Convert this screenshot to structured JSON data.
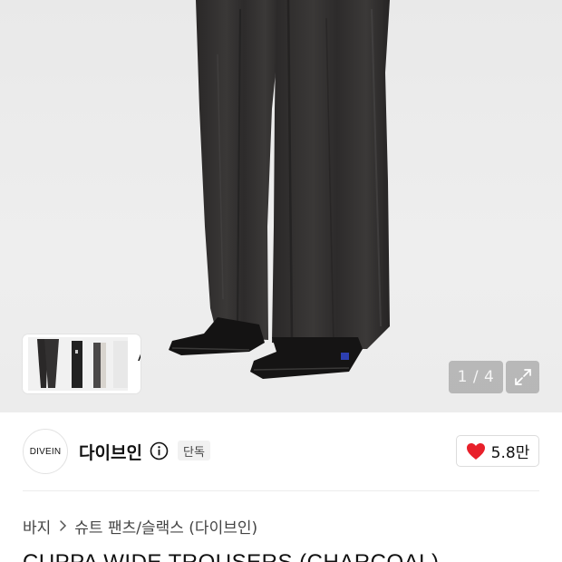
{
  "hero": {
    "image_desc": "charcoal wide trousers product photo",
    "thumbs_ai_label": "AI",
    "counter_text": "1 / 4",
    "icons": {
      "chevron": "chevron-right-icon",
      "expand": "expand-icon"
    }
  },
  "brand": {
    "logo_text": "DIVEIN",
    "name": "다이브인",
    "badge": "단독",
    "like_count": "5.8만",
    "colors": {
      "heart": "#e8202a"
    }
  },
  "breadcrumb": {
    "items": [
      "바지",
      "슈트 팬츠/슬랙스 (다이브인)"
    ]
  },
  "product": {
    "title": "CUPPA WIDE TROUSERS (CHARCOAL)"
  }
}
